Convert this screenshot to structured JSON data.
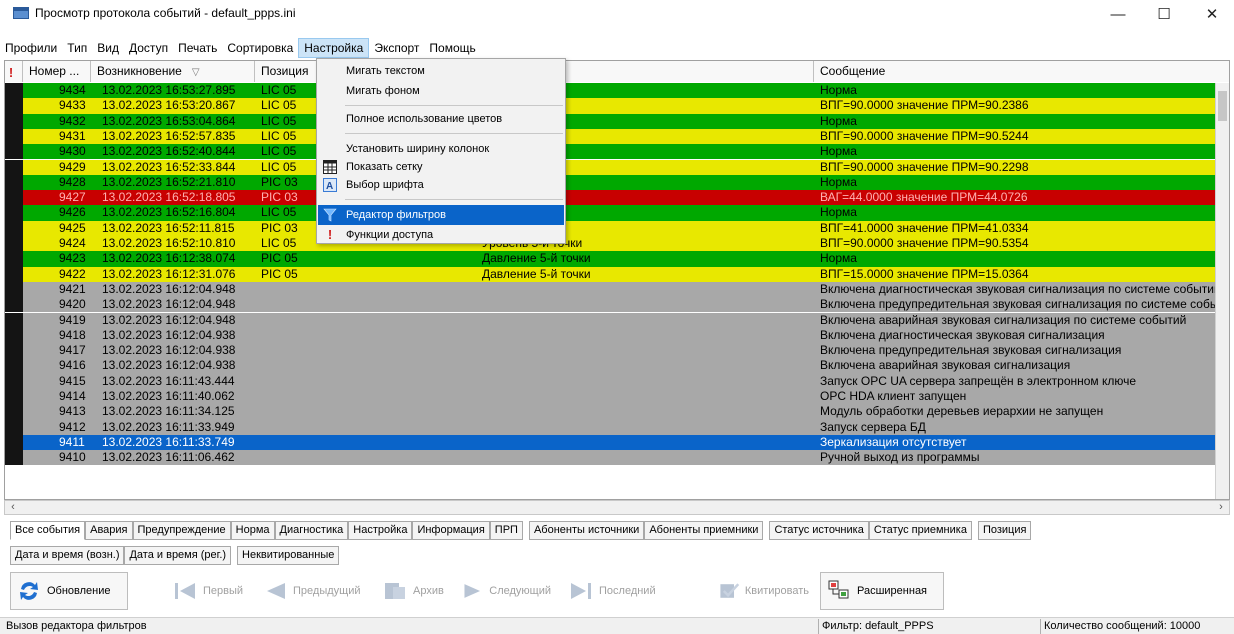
{
  "window": {
    "title": "Просмотр протокола событий - default_ppps.ini",
    "minimize": "—",
    "maximize": "☐",
    "close": "✕"
  },
  "menu": [
    "Профили",
    "Тип",
    "Вид",
    "Доступ",
    "Печать",
    "Сортировка",
    "Настройка",
    "Экспорт",
    "Помощь"
  ],
  "dropdown": {
    "items": [
      {
        "label": "Мигать текстом"
      },
      {
        "label": "Мигать фоном"
      },
      {
        "label": "Полное использование цветов"
      },
      {
        "label": "Установить ширину колонок"
      },
      {
        "label": "Показать сетку"
      },
      {
        "label": "Выбор шрифта"
      },
      {
        "label": "Редактор фильтров"
      },
      {
        "label": "Функции доступа"
      }
    ]
  },
  "grid": {
    "columns": {
      "num": "Номер ...",
      "time": "Возникновение",
      "pos": "Позиция",
      "msg": "Сообщение"
    },
    "rows": [
      {
        "num": "9434",
        "time": "13.02.2023  16:53:27.895",
        "pos": "LIC 05",
        "prm": "ки",
        "msg": "Норма",
        "bg": "#00a800"
      },
      {
        "num": "9433",
        "time": "13.02.2023  16:53:20.867",
        "pos": "LIC 05",
        "prm": "ки",
        "msg": "ВПГ=90.0000  значение ПРМ=90.2386",
        "bg": "#e8e800"
      },
      {
        "num": "9432",
        "time": "13.02.2023  16:53:04.864",
        "pos": "LIC 05",
        "prm": "ки",
        "msg": "Норма",
        "bg": "#00a800"
      },
      {
        "num": "9431",
        "time": "13.02.2023  16:52:57.835",
        "pos": "LIC 05",
        "prm": "ки",
        "msg": "ВПГ=90.0000  значение ПРМ=90.5244",
        "bg": "#e8e800"
      },
      {
        "num": "9430",
        "time": "13.02.2023  16:52:40.844",
        "pos": "LIC 05",
        "prm": "ки",
        "msg": "Норма",
        "bg": "#00a800"
      },
      {
        "num": "9429",
        "time": "13.02.2023  16:52:33.844",
        "pos": "LIC 05",
        "prm": "ки",
        "msg": "ВПГ=90.0000  значение ПРМ=90.2298",
        "bg": "#e8e800"
      },
      {
        "num": "9428",
        "time": "13.02.2023  16:52:21.810",
        "pos": "PIC 03",
        "prm": "чки",
        "msg": "Норма",
        "bg": "#00a800"
      },
      {
        "num": "9427",
        "time": "13.02.2023  16:52:18.805",
        "pos": "PIC 03",
        "prm": "чки",
        "msg": "ВАГ=44.0000  значение ПРМ=44.0726",
        "bg": "#c80000"
      },
      {
        "num": "9426",
        "time": "13.02.2023  16:52:16.804",
        "pos": "LIC 05",
        "prm": "ки",
        "msg": "Норма",
        "bg": "#00a800"
      },
      {
        "num": "9425",
        "time": "13.02.2023  16:52:11.815",
        "pos": "PIC 03",
        "prm": "чки",
        "msg": "ВПГ=41.0000  значение ПРМ=41.0334",
        "bg": "#e8e800"
      },
      {
        "num": "9424",
        "time": "13.02.2023  16:52:10.810",
        "pos": "LIC 05",
        "prm": "Уровень 5-й точки",
        "msg": "ВПГ=90.0000  значение ПРМ=90.5354",
        "bg": "#e8e800"
      },
      {
        "num": "9423",
        "time": "13.02.2023  16:12:38.074",
        "pos": "PIC 05",
        "prm": "Давление 5-й точки",
        "msg": "Норма",
        "bg": "#00a800"
      },
      {
        "num": "9422",
        "time": "13.02.2023  16:12:31.076",
        "pos": "PIC 05",
        "prm": "Давление 5-й точки",
        "msg": "ВПГ=15.0000  значение ПРМ=15.0364",
        "bg": "#e8e800"
      },
      {
        "num": "9421",
        "time": "13.02.2023  16:12:04.948",
        "pos": "",
        "prm": "",
        "msg": "Включена диагностическая звуковая сигнализация по системе событий",
        "bg": "#a8a8a8"
      },
      {
        "num": "9420",
        "time": "13.02.2023  16:12:04.948",
        "pos": "",
        "prm": "",
        "msg": "Включена предупредительная звуковая сигнализация по системе событий",
        "bg": "#a8a8a8"
      },
      {
        "num": "9419",
        "time": "13.02.2023  16:12:04.948",
        "pos": "",
        "prm": "",
        "msg": "Включена аварийная звуковая сигнализация по системе событий",
        "bg": "#a8a8a8"
      },
      {
        "num": "9418",
        "time": "13.02.2023  16:12:04.938",
        "pos": "",
        "prm": "",
        "msg": "Включена диагностическая звуковая сигнализация",
        "bg": "#a8a8a8"
      },
      {
        "num": "9417",
        "time": "13.02.2023  16:12:04.938",
        "pos": "",
        "prm": "",
        "msg": "Включена предупредительная звуковая сигнализация",
        "bg": "#a8a8a8"
      },
      {
        "num": "9416",
        "time": "13.02.2023  16:12:04.938",
        "pos": "",
        "prm": "",
        "msg": "Включена аварийная звуковая сигнализация",
        "bg": "#a8a8a8"
      },
      {
        "num": "9415",
        "time": "13.02.2023  16:11:43.444",
        "pos": "",
        "prm": "",
        "msg": "Запуск OPC UA сервера запрещён в электронном ключе",
        "bg": "#a8a8a8"
      },
      {
        "num": "9414",
        "time": "13.02.2023  16:11:40.062",
        "pos": "",
        "prm": "",
        "msg": "OPC HDA клиент запущен",
        "bg": "#a8a8a8"
      },
      {
        "num": "9413",
        "time": "13.02.2023  16:11:34.125",
        "pos": "",
        "prm": "",
        "msg": "Модуль обработки деревьев иерархии не запущен",
        "bg": "#a8a8a8"
      },
      {
        "num": "9412",
        "time": "13.02.2023  16:11:33.949",
        "pos": "",
        "prm": "",
        "msg": "Запуск сервера БД",
        "bg": "#a8a8a8"
      },
      {
        "num": "9411",
        "time": "13.02.2023  16:11:33.749",
        "pos": "",
        "prm": "",
        "msg": "Зеркализация отсутствует",
        "bg": "#0a64c9"
      },
      {
        "num": "9410",
        "time": "13.02.2023  16:11:06.462",
        "pos": "",
        "prm": "",
        "msg": "Ручной выход из программы",
        "bg": "#a8a8a8"
      }
    ]
  },
  "tabs_row1": [
    "Все события",
    "Авария",
    "Предупреждение",
    "Норма",
    "Диагностика",
    "Настройка",
    "Информация",
    "ПРП",
    "Абоненты источники",
    "Абоненты приемники",
    "Статус источника",
    "Статус приемника",
    "Позиция"
  ],
  "tabs_row2": [
    "Дата и время (возн.)",
    "Дата и время (рег.)",
    "Неквитированные"
  ],
  "toolbar": {
    "refresh": "Обновление",
    "first": "Первый",
    "prev": "Предыдущий",
    "archive": "Архив",
    "next": "Следующий",
    "last": "Последний",
    "ack": "Квитировать",
    "extended": "Расширенная"
  },
  "status": {
    "hint": "Вызов редактора фильтров",
    "filter": "Фильтр: default_PPPS",
    "count": "Количество сообщений: 10000"
  },
  "colors": {
    "norm": "#00a800",
    "warning": "#e8e800",
    "alarm": "#c80000",
    "info": "#a8a8a8",
    "selected": "#0a64c9"
  }
}
